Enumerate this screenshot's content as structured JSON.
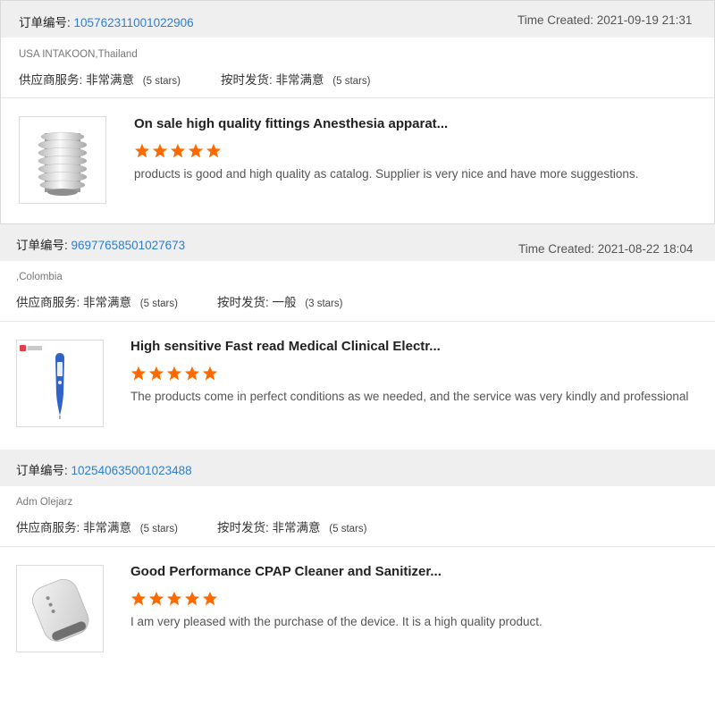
{
  "colors": {
    "accent_link": "#2c7fd0",
    "star": "#ff6a00",
    "header_bg": "#efefef"
  },
  "reviews": [
    {
      "order_label": "订单编号:",
      "order_number": "105762311001022906",
      "time_created": "Time Created: 2021-09-19 21:31",
      "buyer": "USA INTAKOON,Thailand",
      "supplier_service_label": "供应商服务:",
      "supplier_service_value": "非常满意",
      "supplier_service_stars": "(5 stars)",
      "shipping_label": "按时发货:",
      "shipping_value": "非常满意",
      "shipping_stars": "(5 stars)",
      "product_title": "On sale high quality fittings Anesthesia apparat...",
      "product_image": "bellows-fitting",
      "rating": 5,
      "comment": "products is good and high quality as catalog. Supplier is very nice and have more suggestions."
    },
    {
      "order_label": "订单编号:",
      "order_number": "96977658501027673",
      "time_created": "Time Created: 2021-08-22 18:04",
      "buyer": ",Colombia",
      "supplier_service_label": "供应商服务:",
      "supplier_service_value": "非常满意",
      "supplier_service_stars": "(5 stars)",
      "shipping_label": "按时发货:",
      "shipping_value": "一般",
      "shipping_stars": "(3 stars)",
      "product_title": "High sensitive Fast read Medical Clinical Electr...",
      "product_image": "digital-thermometer",
      "rating": 5,
      "comment": "The products come in perfect conditions as we needed, and the service was very kindly and professional"
    },
    {
      "order_label": "订单编号:",
      "order_number": "102540635001023488",
      "time_created": "",
      "buyer": "Adm Olejarz",
      "supplier_service_label": "供应商服务:",
      "supplier_service_value": "非常满意",
      "supplier_service_stars": "(5 stars)",
      "shipping_label": "按时发货:",
      "shipping_value": "非常满意",
      "shipping_stars": "(5 stars)",
      "product_title": "Good Performance CPAP Cleaner and Sanitizer...",
      "product_image": "cpap-cleaner",
      "rating": 5,
      "comment": "I am very pleased with the purchase of the device. It is a high quality product."
    }
  ]
}
